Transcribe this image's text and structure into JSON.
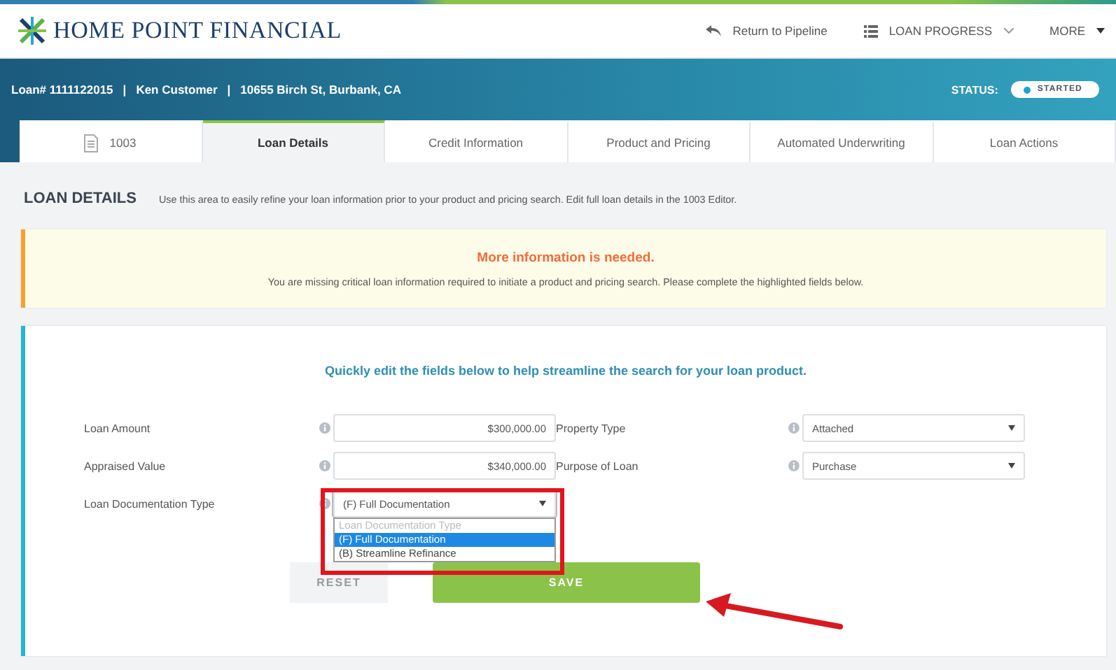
{
  "header": {
    "logo": "HOME POINT FINANCIAL",
    "return_link": "Return to Pipeline",
    "progress_menu": "LOAN PROGRESS",
    "more_menu": "MORE"
  },
  "loan_bar": {
    "loan_number": "Loan# 1111122015",
    "separator_1": "|",
    "customer": "Ken Customer",
    "separator_2": "|",
    "address": "10655 Birch St, Burbank, CA",
    "status_label": "STATUS:",
    "status": "STARTED"
  },
  "tabs": [
    {
      "label": "1003",
      "kind": "document",
      "selected": false
    },
    {
      "label": "Loan Details",
      "kind": "plain",
      "selected": true
    },
    {
      "label": "Credit Information",
      "kind": "plain",
      "selected": false
    },
    {
      "label": "Product and Pricing",
      "kind": "plain",
      "selected": false
    },
    {
      "label": "Automated Underwriting",
      "kind": "plain",
      "selected": false
    },
    {
      "label": "Loan Actions",
      "kind": "plain",
      "selected": false
    }
  ],
  "page": {
    "title": "LOAN DETAILS",
    "description": "Use this area to easily refine your loan information prior to your product and pricing search. Edit full loan details in the 1003 Editor."
  },
  "alert": {
    "title": "More information is needed.",
    "message": "You are missing critical loan information required to initiate a product and pricing search. Please complete the highlighted fields below."
  },
  "form": {
    "intro": "Quickly edit the fields below to help streamline the search for your loan product.",
    "columns": [
      [
        {
          "label": "Loan Amount",
          "kind": "input",
          "value": "$300,000.00"
        },
        {
          "label": "Appraised Value",
          "kind": "input",
          "value": "$340,000.00"
        },
        {
          "label": "Loan Documentation Type",
          "kind": "select",
          "value": "(F) Full Documentation",
          "expanded": true,
          "options": [
            {
              "label": "Loan Documentation Type",
              "disabled": true,
              "selected": false
            },
            {
              "label": "(F) Full Documentation",
              "disabled": false,
              "selected": true
            },
            {
              "label": "(B) Streamline Refinance",
              "disabled": false,
              "selected": false
            }
          ]
        }
      ],
      [
        {
          "label": "Property Type",
          "kind": "select",
          "value": "Attached",
          "expanded": false
        },
        {
          "label": "Purpose of Loan",
          "kind": "select",
          "value": "Purchase",
          "expanded": false
        }
      ]
    ],
    "buttons": [
      {
        "label": "RESET",
        "kind": "secondary"
      },
      {
        "label": "SAVE",
        "kind": "primary"
      }
    ]
  },
  "annotations": {
    "highlight_frame": true,
    "arrow": true
  }
}
